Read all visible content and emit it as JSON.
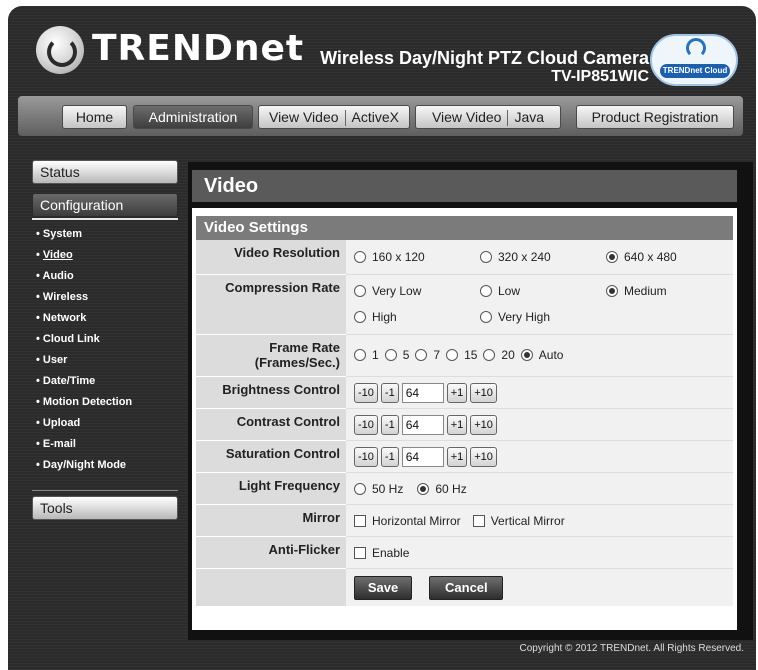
{
  "header": {
    "brand": "TRENDnet",
    "product_title": "Wireless Day/Night PTZ Cloud Camera",
    "product_model": "TV-IP851WIC",
    "cloud_badge": "TRENDnet Cloud"
  },
  "nav": {
    "home": "Home",
    "administration": "Administration",
    "view_video_activex": [
      "View Video",
      "ActiveX"
    ],
    "view_video_java": [
      "View Video",
      "Java"
    ],
    "product_registration": "Product Registration"
  },
  "sidebar": {
    "status": "Status",
    "configuration": "Configuration",
    "items": [
      "System",
      "Video",
      "Audio",
      "Wireless",
      "Network",
      "Cloud Link",
      "User",
      "Date/Time",
      "Motion Detection",
      "Upload",
      "E-mail",
      "Day/Night Mode"
    ],
    "tools": "Tools"
  },
  "main": {
    "title": "Video",
    "section_title": "Video Settings",
    "resolution": {
      "label": "Video Resolution",
      "options": [
        "160 x 120",
        "320 x 240",
        "640 x 480"
      ],
      "selected": "640 x 480"
    },
    "compression": {
      "label": "Compression Rate",
      "options": [
        "Very Low",
        "Low",
        "Medium",
        "High",
        "Very High"
      ],
      "selected": "Medium"
    },
    "frame_rate": {
      "label": "Frame Rate",
      "label2": "(Frames/Sec.)",
      "options": [
        "1",
        "5",
        "7",
        "15",
        "20",
        "Auto"
      ],
      "selected": "Auto"
    },
    "brightness": {
      "label": "Brightness Control",
      "value": "64"
    },
    "contrast": {
      "label": "Contrast Control",
      "value": "64"
    },
    "saturation": {
      "label": "Saturation Control",
      "value": "64"
    },
    "steps": [
      "-10",
      "-1",
      "+1",
      "+10"
    ],
    "light_frequency": {
      "label": "Light Frequency",
      "options": [
        "50 Hz",
        "60 Hz"
      ],
      "selected": "60 Hz"
    },
    "mirror": {
      "label": "Mirror",
      "horizontal": "Horizontal Mirror",
      "vertical": "Vertical Mirror"
    },
    "anti_flicker": {
      "label": "Anti-Flicker",
      "enable": "Enable"
    },
    "save": "Save",
    "cancel": "Cancel"
  },
  "footer": {
    "copyright": "Copyright © 2012 TRENDnet.  All Rights Reserved."
  }
}
